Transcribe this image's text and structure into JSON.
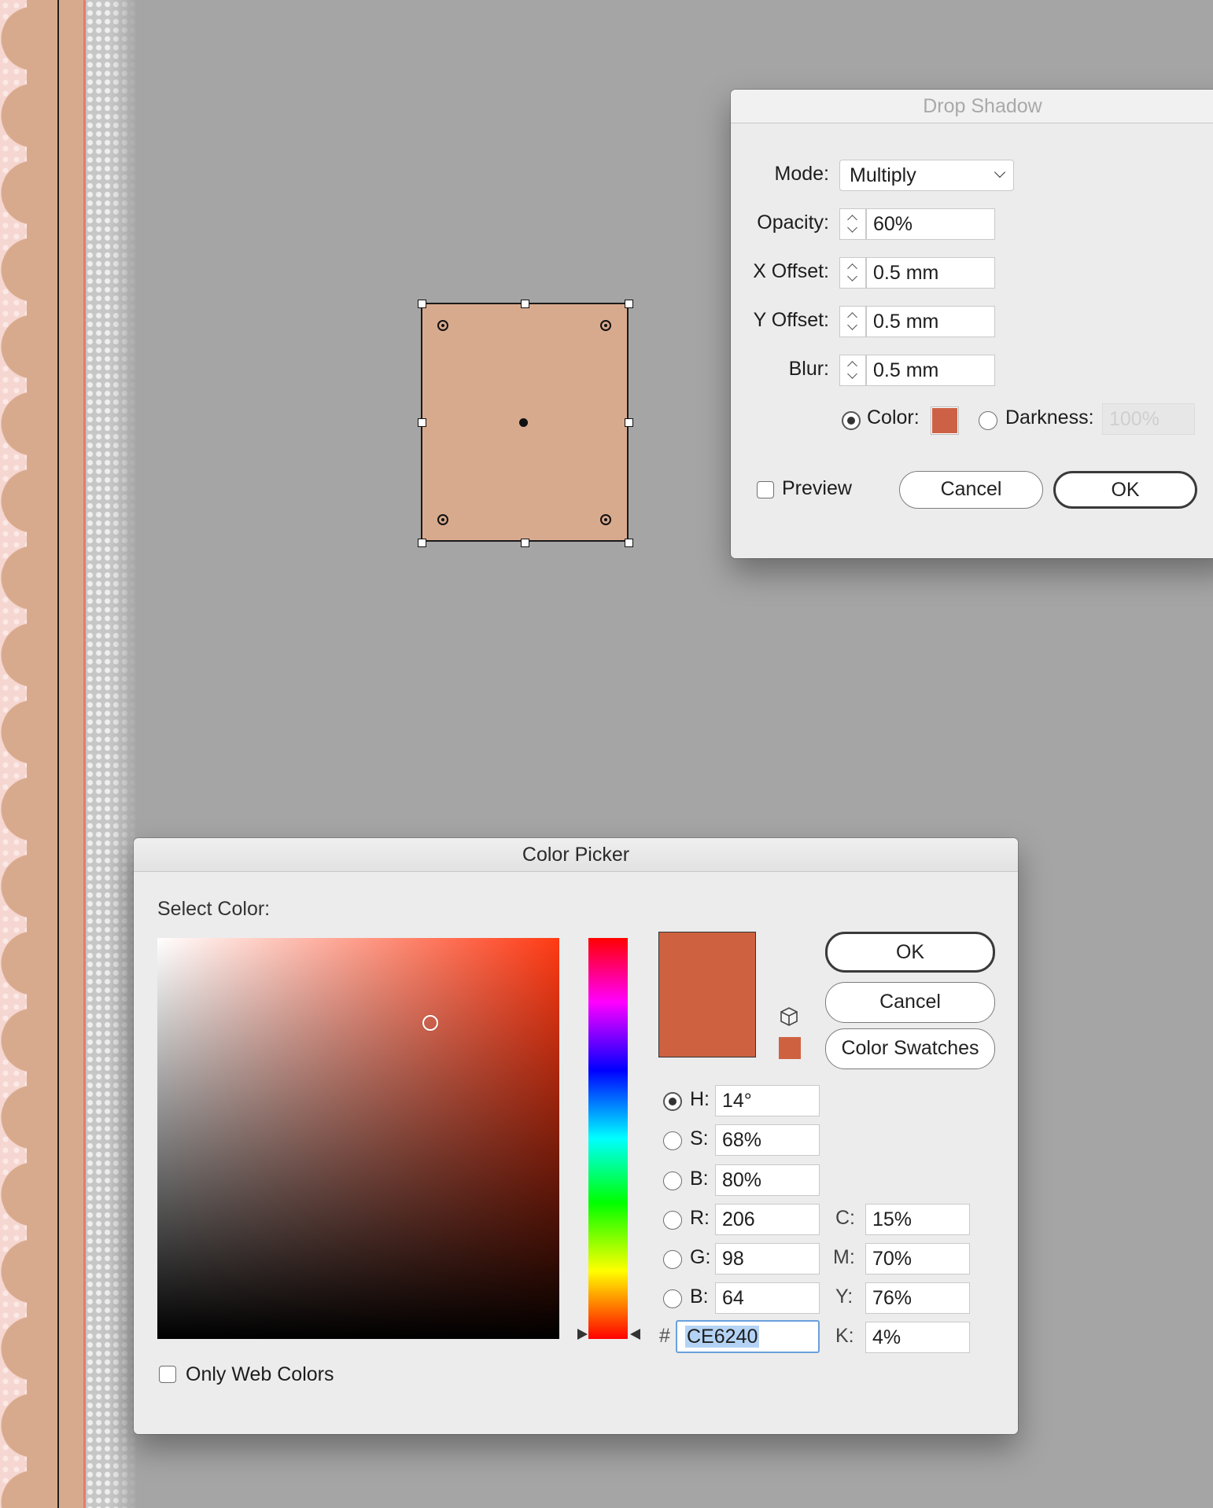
{
  "canvas": {
    "page_color": "#d8aa8d",
    "frame_fill": "#d8aa8d"
  },
  "drop_shadow": {
    "title": "Drop Shadow",
    "mode_label": "Mode:",
    "mode_value": "Multiply",
    "opacity_label": "Opacity:",
    "opacity_value": "60%",
    "x_offset_label": "X Offset:",
    "x_offset_value": "0.5 mm",
    "y_offset_label": "Y Offset:",
    "y_offset_value": "0.5 mm",
    "blur_label": "Blur:",
    "blur_value": "0.5 mm",
    "color_label": "Color:",
    "color_value": "#cc6145",
    "darkness_label": "Darkness:",
    "darkness_value": "100%",
    "preview_label": "Preview",
    "cancel_label": "Cancel",
    "ok_label": "OK"
  },
  "color_picker": {
    "title": "Color Picker",
    "select_color_label": "Select Color:",
    "ok_label": "OK",
    "cancel_label": "Cancel",
    "swatches_label": "Color Swatches",
    "current_color": "#ce6240",
    "fields": {
      "h_label": "H:",
      "h_value": "14°",
      "s_label": "S:",
      "s_value": "68%",
      "b_label": "B:",
      "b_value": "80%",
      "r_label": "R:",
      "r_value": "206",
      "g_label": "G:",
      "g_value": "98",
      "b2_label": "B:",
      "b2_value": "64",
      "hex_label": "#",
      "hex_value": "CE6240",
      "c_label": "C:",
      "c_value": "15%",
      "m_label": "M:",
      "m_value": "70%",
      "y_label": "Y:",
      "y_value": "76%",
      "k_label": "K:",
      "k_value": "4%"
    },
    "only_web_colors_label": "Only Web Colors"
  }
}
